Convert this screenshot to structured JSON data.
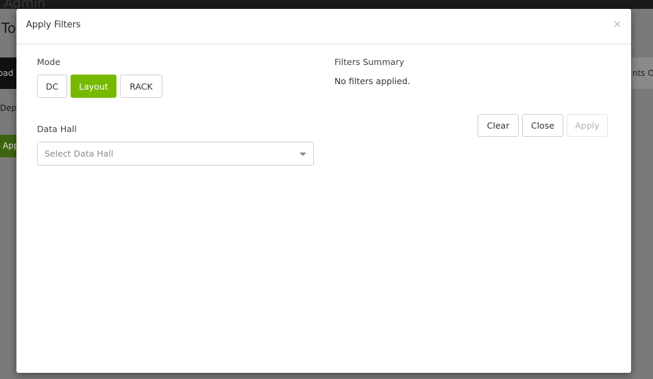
{
  "background": {
    "app_name": "Admin",
    "page_title": "Top",
    "left_dark_button": "oad",
    "right_gray_button": "nts O",
    "left_status": "Depl",
    "left_green_button": "App"
  },
  "modal": {
    "title": "Apply Filters",
    "close_glyph": "×",
    "mode": {
      "label": "Mode",
      "options": [
        "DC",
        "Layout",
        "RACK"
      ],
      "selected": "Layout"
    },
    "data_hall": {
      "label": "Data Hall",
      "placeholder": "Select Data Hall"
    },
    "summary": {
      "label": "Filters Summary",
      "text": "No filters applied."
    },
    "actions": {
      "clear": "Clear",
      "close": "Close",
      "apply": "Apply"
    }
  },
  "colors": {
    "accent": "#76b900",
    "overlay": "#7a7a7a"
  }
}
